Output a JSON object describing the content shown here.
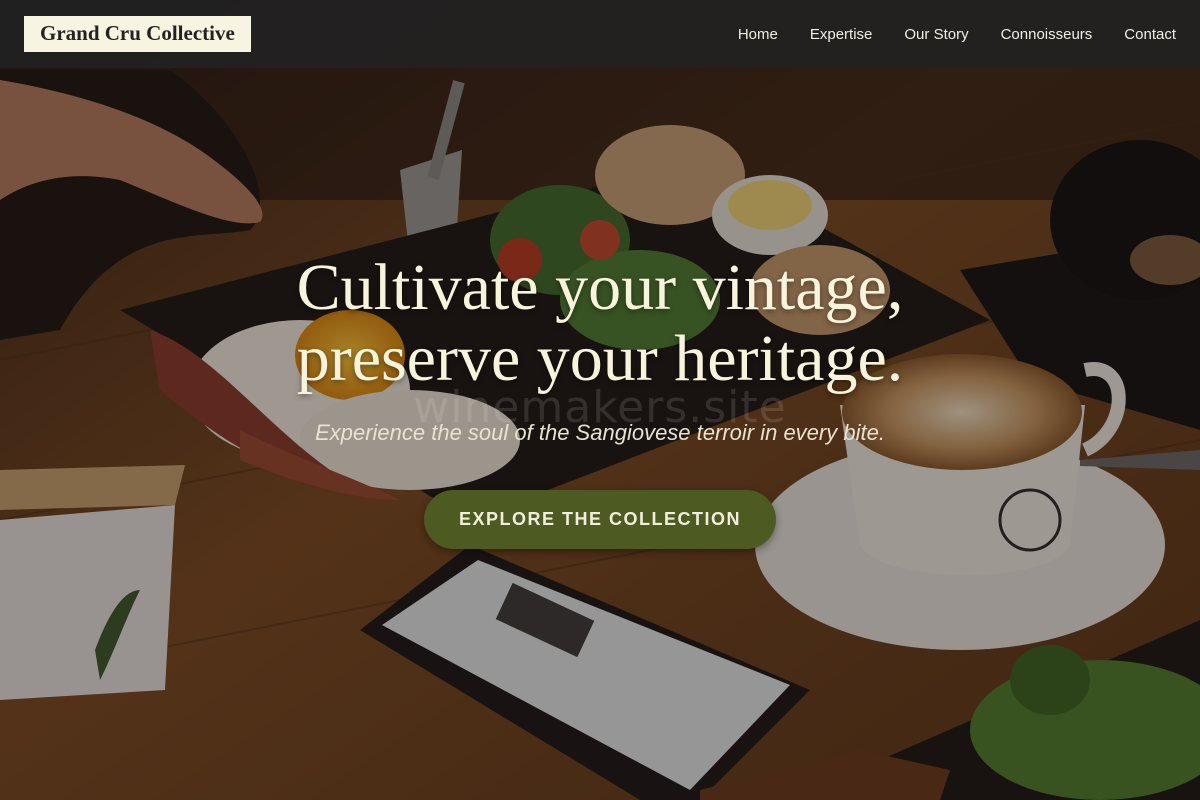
{
  "brand": {
    "name": "Grand Cru Collective"
  },
  "nav": {
    "items": [
      {
        "label": "Home"
      },
      {
        "label": "Expertise"
      },
      {
        "label": "Our Story"
      },
      {
        "label": "Connoisseurs"
      },
      {
        "label": "Contact"
      }
    ]
  },
  "hero": {
    "headline_line1": "Cultivate your vintage,",
    "headline_line2": "preserve your heritage.",
    "watermark": "winemakers.site",
    "tagline": "Experience the soul of the Sangiovese terroir in every bite.",
    "cta_label": "EXPLORE THE COLLECTION"
  },
  "colors": {
    "navbar_bg": "#222222",
    "brand_bg": "#f7f5e1",
    "headline": "#f8f4dc",
    "cta_bg": "#4d5a21",
    "cta_text": "#f1eedc"
  }
}
